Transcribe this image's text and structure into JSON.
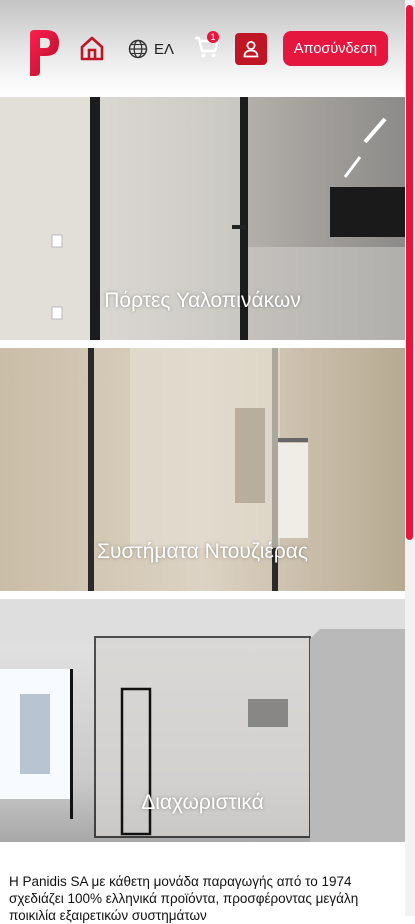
{
  "header": {
    "language_label": "ΕΛ",
    "cart_count": "1",
    "logout_label": "Αποσύνδεση",
    "brand_color": "#e5173f",
    "icons": [
      "panidis-logo-icon",
      "home-icon",
      "globe-icon",
      "cart-icon",
      "user-icon"
    ]
  },
  "categories": [
    {
      "label": "Πόρτες Υαλοπινάκων"
    },
    {
      "label": "Συστήματα Ντουζιέρας"
    },
    {
      "label": "Διαχωριστικά"
    }
  ],
  "about": {
    "text": "Η Panidis SA με κάθετη μονάδα παραγωγής από το 1974 σχεδιάζει 100% ελληνικά προϊόντα, προσφέροντας μεγάλη ποικιλία εξαιρετικών συστημάτων"
  }
}
